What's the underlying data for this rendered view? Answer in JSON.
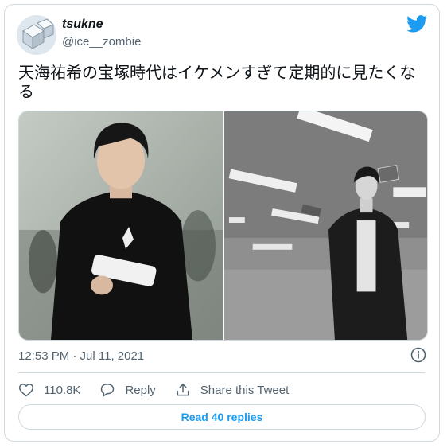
{
  "tweet": {
    "display_name": "tsukne",
    "handle": "@ice__zombie",
    "text": "天海祐希の宝塚時代はイケメンすぎて定期的に見たくなる",
    "timestamp": "12:53 PM · Jul 11, 2021",
    "likes": "110.8K",
    "reply_label": "Reply",
    "share_label": "Share this Tweet",
    "read_replies_label": "Read 40 replies"
  },
  "icons": {
    "brand": "twitter-bird-icon",
    "info": "info-icon",
    "like": "heart-icon",
    "reply": "reply-bubble-icon",
    "share": "share-icon"
  },
  "colors": {
    "accent": "#1d9bf0",
    "text": "#0f1419",
    "secondary": "#536471",
    "border": "#cfd9de"
  }
}
